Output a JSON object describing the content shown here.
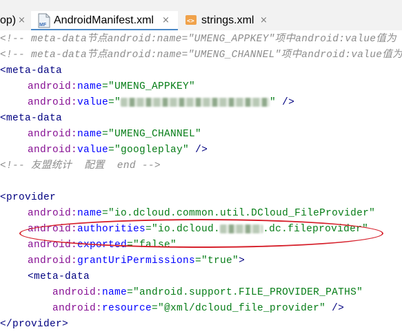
{
  "tabs": [
    {
      "label": "op)",
      "closable": true,
      "active": false
    },
    {
      "label": "AndroidManifest.xml",
      "closable": true,
      "active": true,
      "icon": "manifest-icon"
    },
    {
      "label": "strings.xml",
      "closable": true,
      "active": false,
      "icon": "xml-file-icon"
    }
  ],
  "close_glyph": "×",
  "icons": {
    "mf_label": "MF",
    "xml_label": "<>"
  },
  "code": {
    "l1": "<!-- meta-data节点android:name=\"UMENG_APPKEY\"项中android:value值为",
    "l2": "<!-- meta-data节点android:name=\"UMENG_CHANNEL\"项中android:value值为",
    "l3_tag": "<meta-data",
    "l4_ns": "android:",
    "l4_attr": "name",
    "l4_val": "=\"UMENG_APPKEY\"",
    "l5_ns": "android:",
    "l5_attr": "value",
    "l5_val_open": "=\"",
    "l5_val_close": "\"",
    "l5_end": " />",
    "l6_tag": "<meta-data",
    "l7_ns": "android:",
    "l7_attr": "name",
    "l7_val": "=\"UMENG_CHANNEL\"",
    "l8_ns": "android:",
    "l8_attr": "value",
    "l8_val": "=\"googleplay\"",
    "l8_end": " />",
    "l9": "<!-- 友盟统计  配置  end -->",
    "l11_tag": "<provider",
    "l12_ns": "android:",
    "l12_attr": "name",
    "l12_val": "=\"io.dcloud.common.util.DCloud_FileProvider\"",
    "l13_ns": "android:",
    "l13_attr": "authorities",
    "l13_val_a": "=\"io.dcloud.",
    "l13_val_b": ".dc.fileprovider\"",
    "l14_ns": "android:",
    "l14_attr": "exported",
    "l14_val": "=\"false\"",
    "l15_ns": "android:",
    "l15_attr": "grantUriPermissions",
    "l15_val": "=\"true\"",
    "l15_end": ">",
    "l16_tag": "<meta-data",
    "l17_ns": "android:",
    "l17_attr": "name",
    "l17_val": "=\"android.support.FILE_PROVIDER_PATHS\"",
    "l18_ns": "android:",
    "l18_attr": "resource",
    "l18_val": "=\"@xml/dcloud_file_provider\"",
    "l18_end": " />",
    "l19_tag": "</provider>"
  },
  "colors": {
    "comment": "#8c8c8c",
    "tag": "#000080",
    "namespace": "#871094",
    "attribute": "#0000ff",
    "value": "#067d17",
    "annotation": "#d6202b",
    "active_tab": "#4a88c7"
  }
}
